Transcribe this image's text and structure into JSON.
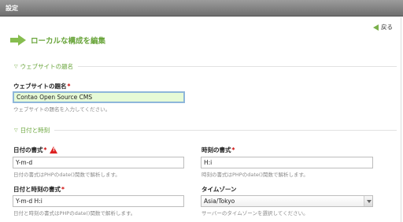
{
  "window": {
    "title": "設定"
  },
  "back": {
    "label": "戻る"
  },
  "page": {
    "heading": "ローカルな構成を編集"
  },
  "sections": {
    "site_name": {
      "legend": "ウェブサイトの題名"
    },
    "datetime": {
      "legend": "日付と時刻"
    }
  },
  "fields": {
    "site_title": {
      "label": "ウェブサイトの題名",
      "value": "Contao Open Source CMS",
      "hint": "ウェブサイトの題名を入力してください。"
    },
    "date_format": {
      "label": "日付の書式",
      "value": "Y-m-d",
      "hint": "日付の書式はPHPのdate()関数で解析します。"
    },
    "time_format": {
      "label": "時刻の書式",
      "value": "H:i",
      "hint": "時刻の書式はPHPのdate()関数で解析します。"
    },
    "datim_format": {
      "label": "日付と時刻の書式",
      "value": "Y-m-d H:i",
      "hint": "日付と時刻の書式はPHPのdate()関数で解析します。"
    },
    "timezone": {
      "label": "タイムゾーン",
      "value": "Asia/Tokyo",
      "hint": "サーバーのタイムゾーンを選択してください。"
    }
  },
  "required_marker": "*",
  "colors": {
    "accent_green": "#6aa53c",
    "required_red": "#cc0000",
    "active_input_bg": "#e6fad6"
  }
}
